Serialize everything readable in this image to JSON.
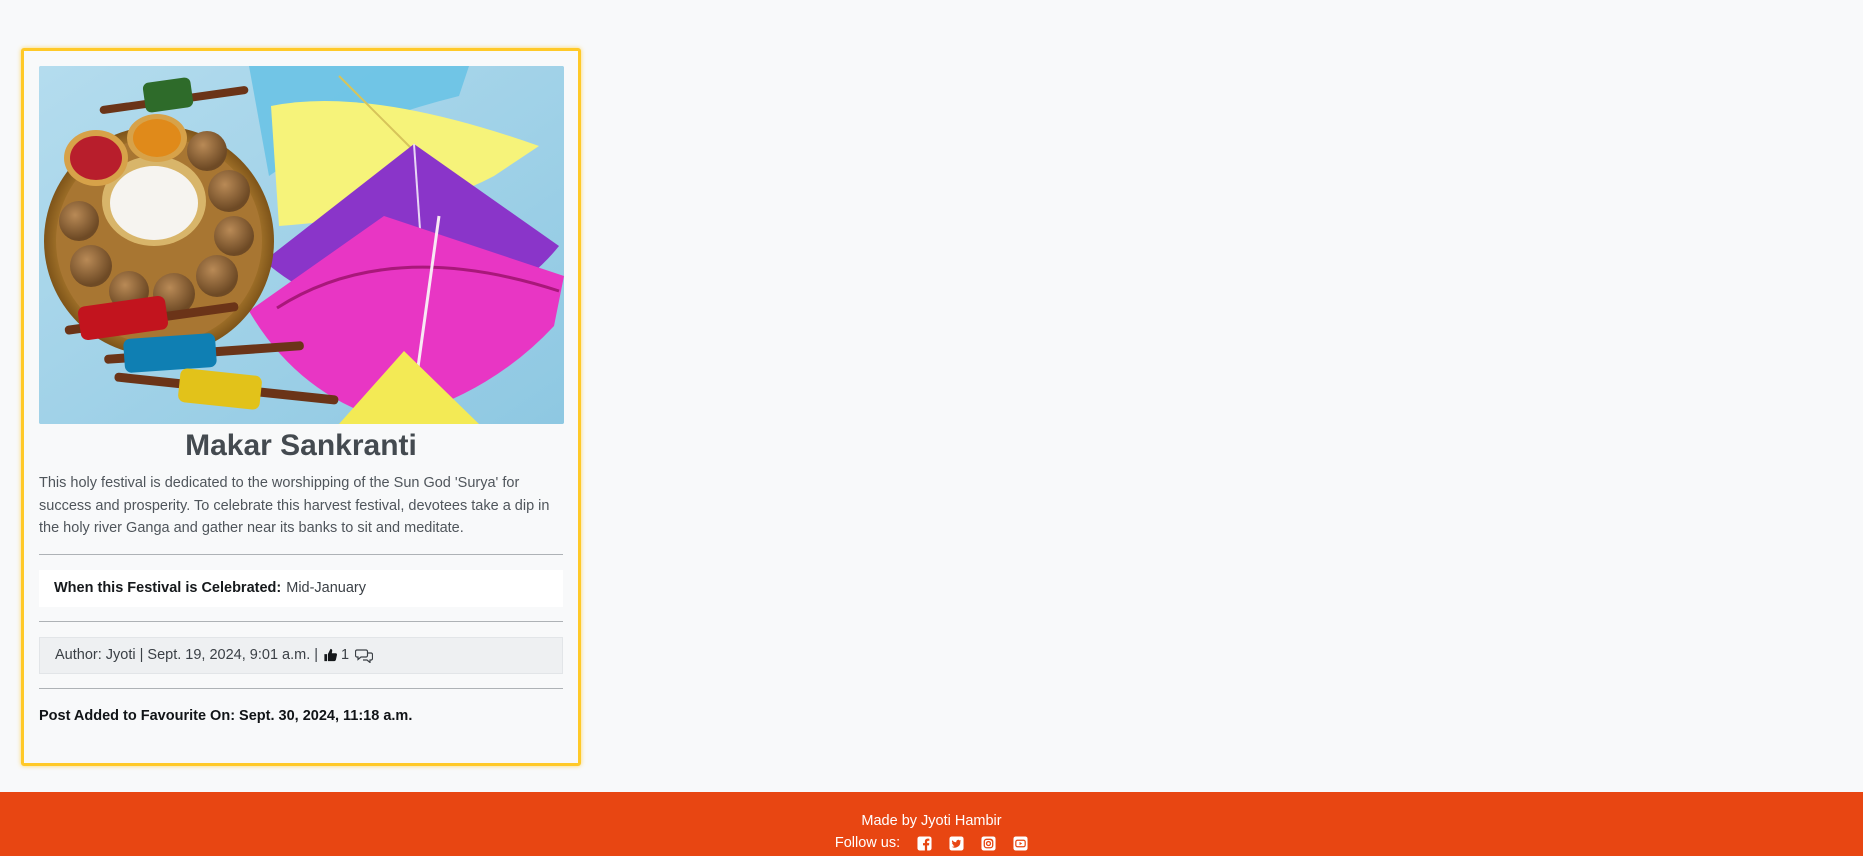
{
  "card": {
    "image_alt": "Colorful kites, thread spools and sweets on a platter",
    "title": "Makar Sankranti",
    "description": "This holy festival is dedicated to the worshipping of the Sun God 'Surya' for success and prosperity. To celebrate this harvest festival, devotees take a dip in the holy river Ganga and gather near its banks to sit and meditate.",
    "when_label": "When this Festival is Celebrated:",
    "when_value": "Mid-January",
    "author_text": "Author: Jyoti | Sept. 19, 2024, 9:01 a.m. |",
    "likes_count": "1",
    "favourite_text": "Post Added to Favourite On: Sept. 30, 2024, 11:18 a.m."
  },
  "footer": {
    "made_by": "Made by Jyoti Hambir",
    "follow_label": "Follow us:",
    "social_icons": [
      "facebook-icon",
      "twitter-icon",
      "instagram-icon",
      "youtube-icon"
    ]
  },
  "colors": {
    "accent_border": "#ffc928",
    "footer_bg": "#e84612",
    "page_bg": "#f8f9fa"
  }
}
